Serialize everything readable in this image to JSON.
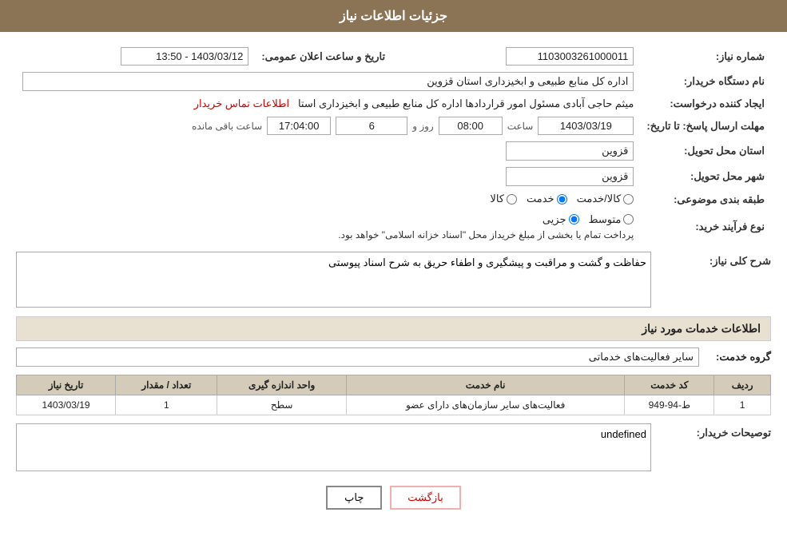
{
  "header": {
    "title": "جزئیات اطلاعات نیاز"
  },
  "fields": {
    "need_number_label": "شماره نیاز:",
    "need_number_value": "1103003261000011",
    "announce_datetime_label": "تاریخ و ساعت اعلان عمومی:",
    "announce_datetime_value": "1403/03/12 - 13:50",
    "buyer_org_label": "نام دستگاه خریدار:",
    "buyer_org_value": "اداره کل منابع طبیعی و ابخیزداری استان قزوین",
    "creator_label": "ایجاد کننده درخواست:",
    "creator_value": "میثم حاجی آبادی مسئول امور قراردادها اداره کل منابع طبیعی و ابخیزداری استا",
    "creator_link": "اطلاعات تماس خریدار",
    "reply_deadline_label": "مهلت ارسال پاسخ: تا تاریخ:",
    "reply_date_value": "1403/03/19",
    "reply_time_value": "08:00",
    "reply_days_label": "روز و",
    "reply_days_value": "6",
    "reply_remaining_label": "ساعت باقی مانده",
    "reply_remaining_value": "17:04:00",
    "province_label": "استان محل تحویل:",
    "province_value": "قزوین",
    "city_label": "شهر محل تحویل:",
    "city_value": "قزوین",
    "category_label": "طبقه بندی موضوعی:",
    "category_options": [
      "کالا",
      "خدمت",
      "کالا/خدمت"
    ],
    "category_selected": "خدمت",
    "purchase_type_label": "نوع فرآیند خرید:",
    "purchase_types": [
      "جزیی",
      "متوسط"
    ],
    "purchase_note": "پرداخت تمام یا بخشی از مبلغ خریداز محل \"اسناد خزانه اسلامی\" خواهد بود.",
    "need_description_label": "شرح کلی نیاز:",
    "need_description_value": "حفاظت و گشت و مراقبت و پیشگیری و اطفاء حریق به شرح اسناد پیوستی"
  },
  "services_section": {
    "title": "اطلاعات خدمات مورد نیاز",
    "service_group_label": "گروه خدمت:",
    "service_group_value": "سایر فعالیت‌های خدماتی"
  },
  "table": {
    "columns": [
      "ردیف",
      "کد خدمت",
      "نام خدمت",
      "واحد اندازه گیری",
      "تعداد / مقدار",
      "تاریخ نیاز"
    ],
    "rows": [
      {
        "row_num": "1",
        "service_code": "ط-94-949",
        "service_name": "فعالیت‌های سایر سازمان‌های دارای عضو",
        "unit": "سطح",
        "quantity": "1",
        "need_date": "1403/03/19"
      }
    ]
  },
  "buyer_notes_label": "توصیحات خریدار:",
  "buyer_notes_value": "",
  "buttons": {
    "print": "چاپ",
    "return": "بازگشت"
  }
}
